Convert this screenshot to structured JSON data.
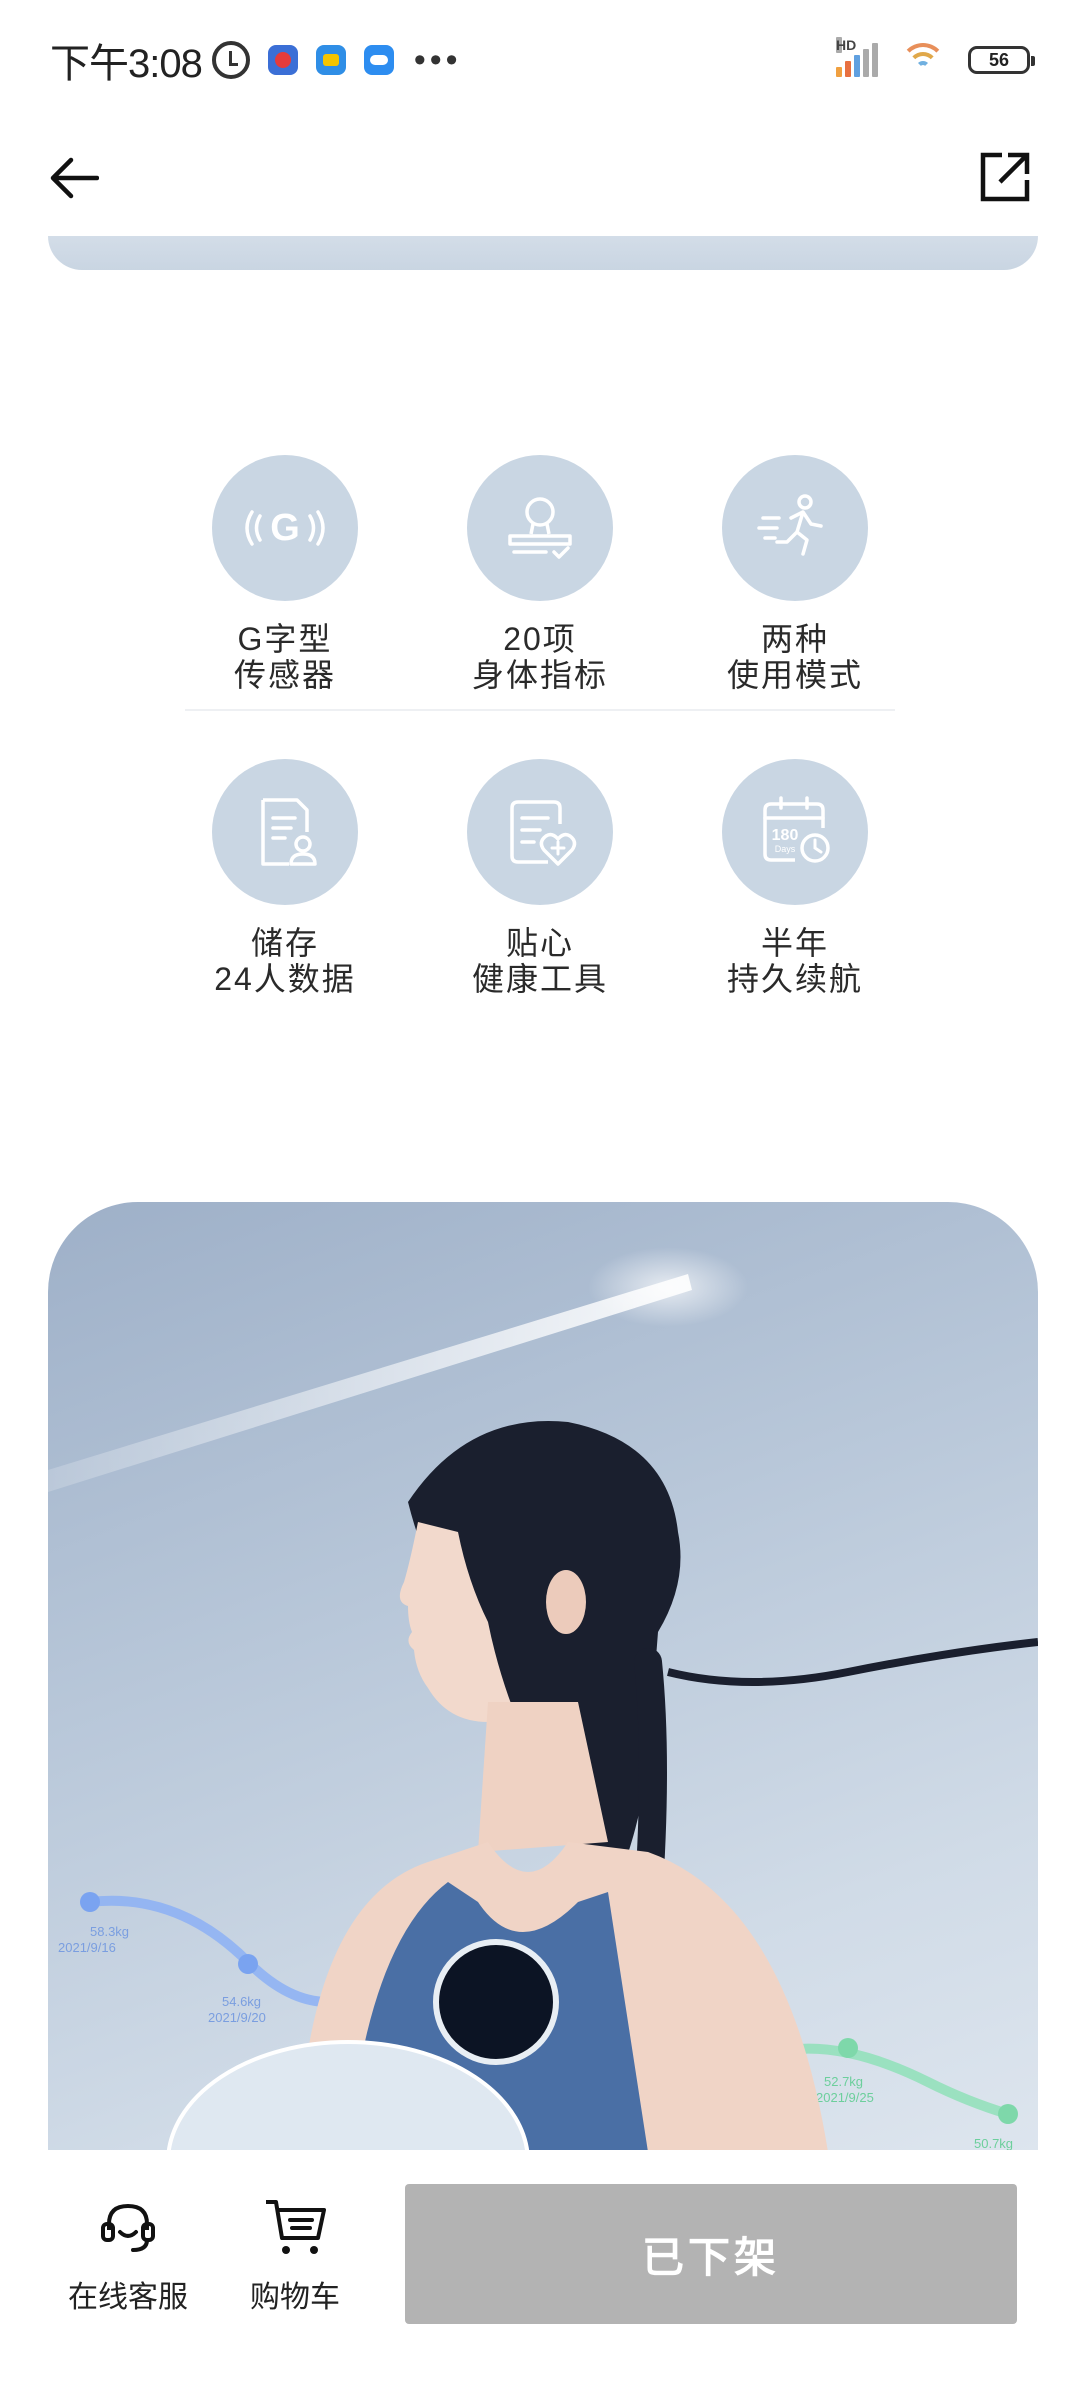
{
  "status_bar": {
    "time": "下午3:08",
    "network_label": "HD",
    "battery_level": "56"
  },
  "nav": {
    "back_icon": "arrow-left-icon",
    "share_icon": "share-external-icon"
  },
  "features": {
    "row1": [
      {
        "icon": "g-sensor-icon",
        "line1": "G字型",
        "line2": "传感器"
      },
      {
        "icon": "body-metrics-icon",
        "line1": "20项",
        "line2": "身体指标"
      },
      {
        "icon": "running-mode-icon",
        "line1": "两种",
        "line2": "使用模式"
      }
    ],
    "row2": [
      {
        "icon": "user-data-icon",
        "line1": "储存",
        "line2": "24人数据"
      },
      {
        "icon": "health-tool-icon",
        "line1": "贴心",
        "line2": "健康工具"
      },
      {
        "icon": "calendar-180-icon",
        "line1": "半年",
        "line2": "持久续航"
      }
    ],
    "calendar_text": "180",
    "calendar_subtext": "Days"
  },
  "hero": {
    "data_points": [
      {
        "weight": "58.3kg",
        "date": "2021/9/16"
      },
      {
        "weight": "54.6kg",
        "date": "2021/9/20"
      },
      {
        "weight": "52.7kg",
        "date": "2021/9/25"
      },
      {
        "weight": "50.7kg",
        "date": ""
      }
    ]
  },
  "bottom_bar": {
    "service_label": "在线客服",
    "cart_label": "购物车",
    "status_button": "已下架"
  }
}
